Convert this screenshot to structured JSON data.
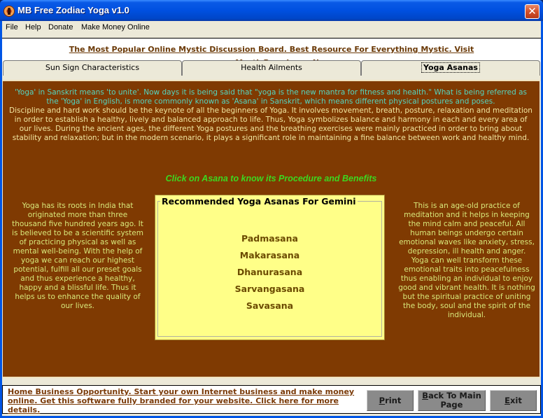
{
  "window": {
    "title": "MB Free Zodiac Yoga v1.0",
    "close_label": "✕"
  },
  "menu": [
    "File",
    "Help",
    "Donate",
    "Make Money Online"
  ],
  "banner": {
    "line1": "The Most Popular Online Mystic Discussion Board. Best Resource For Everything Mystic. Visit",
    "line2": "www.MysticBoard.com Now"
  },
  "tabs": [
    {
      "label": "Sun Sign Characteristics",
      "active": false
    },
    {
      "label": "Health Ailments",
      "active": false
    },
    {
      "label": "Yoga Asanas",
      "active": true
    }
  ],
  "intro": {
    "p1": "'Yoga' in Sanskrit means 'to unite'. Now days it is being said that \"yoga is the new mantra for fitness and health.\" What is being referred as the 'Yoga' in English, is more commonly known as 'Asana' in Sanskrit, which means different physical postures and poses.",
    "p2": "Discipline and hard work should be the keynote of all the beginners of Yoga. It involves movement, breath, posture, relaxation and meditation in order to establish a healthy, lively and balanced approach to life. Thus, Yoga symbolizes balance and harmony in each and every area of our lives. During the ancient ages, the different Yoga postures and the breathing exercises were mainly practiced in order to bring about stability and relaxation; but in the modern scenario, it plays a significant role in maintaining a fine balance between work and healthy mind."
  },
  "click_hint": "Click on Asana to know its Procedure and Benefits",
  "left_text": "Yoga has its roots in India that originated more than three thousand five hundred years ago. It is believed to be a scientific system of practicing physical as well as mental well-being. With the help of yoga we can reach our highest potential, fulfill all our preset goals and thus experience a healthy, happy and a blissful life. Thus it helps us to enhance the quality of our lives.",
  "right_text": "This is an age-old practice of meditation and it helps in keeping the mind calm and peaceful. All human beings undergo certain emotional waves like anxiety, stress, depression, ill health and anger. Yoga can well transform these emotional traits into peacefulness thus enabling an individual to enjoy good and vibrant health. It is nothing but the spiritual practice of uniting the body, soul and the spirit of the individual.",
  "asanas": {
    "title": "Recommended Yoga Asanas For Gemini",
    "items": [
      "Padmasana",
      "Makarasana",
      "Dhanurasana",
      "Sarvangasana",
      "Savasana"
    ]
  },
  "footer": {
    "link": "Home Business Opportunity. Start your own Internet business and make money online. Get this software fully branded for your website. Click here for more details.",
    "buttons": {
      "print": {
        "accel": "P",
        "rest": "rint"
      },
      "back": {
        "accel": "B",
        "rest": "ack To Main",
        "line2": "Page"
      },
      "exit": {
        "accel": "E",
        "rest": "xit"
      }
    }
  },
  "colors": {
    "content_bg": "#7f3a02",
    "intro_p1": "#55d4c0",
    "intro_p2": "#f2e6a0",
    "hint": "#3cd820",
    "side_text": "#d8e87a",
    "asana_box_bg": "#ffff88",
    "asana_item": "#6b4a00",
    "link": "#6b3a08"
  }
}
